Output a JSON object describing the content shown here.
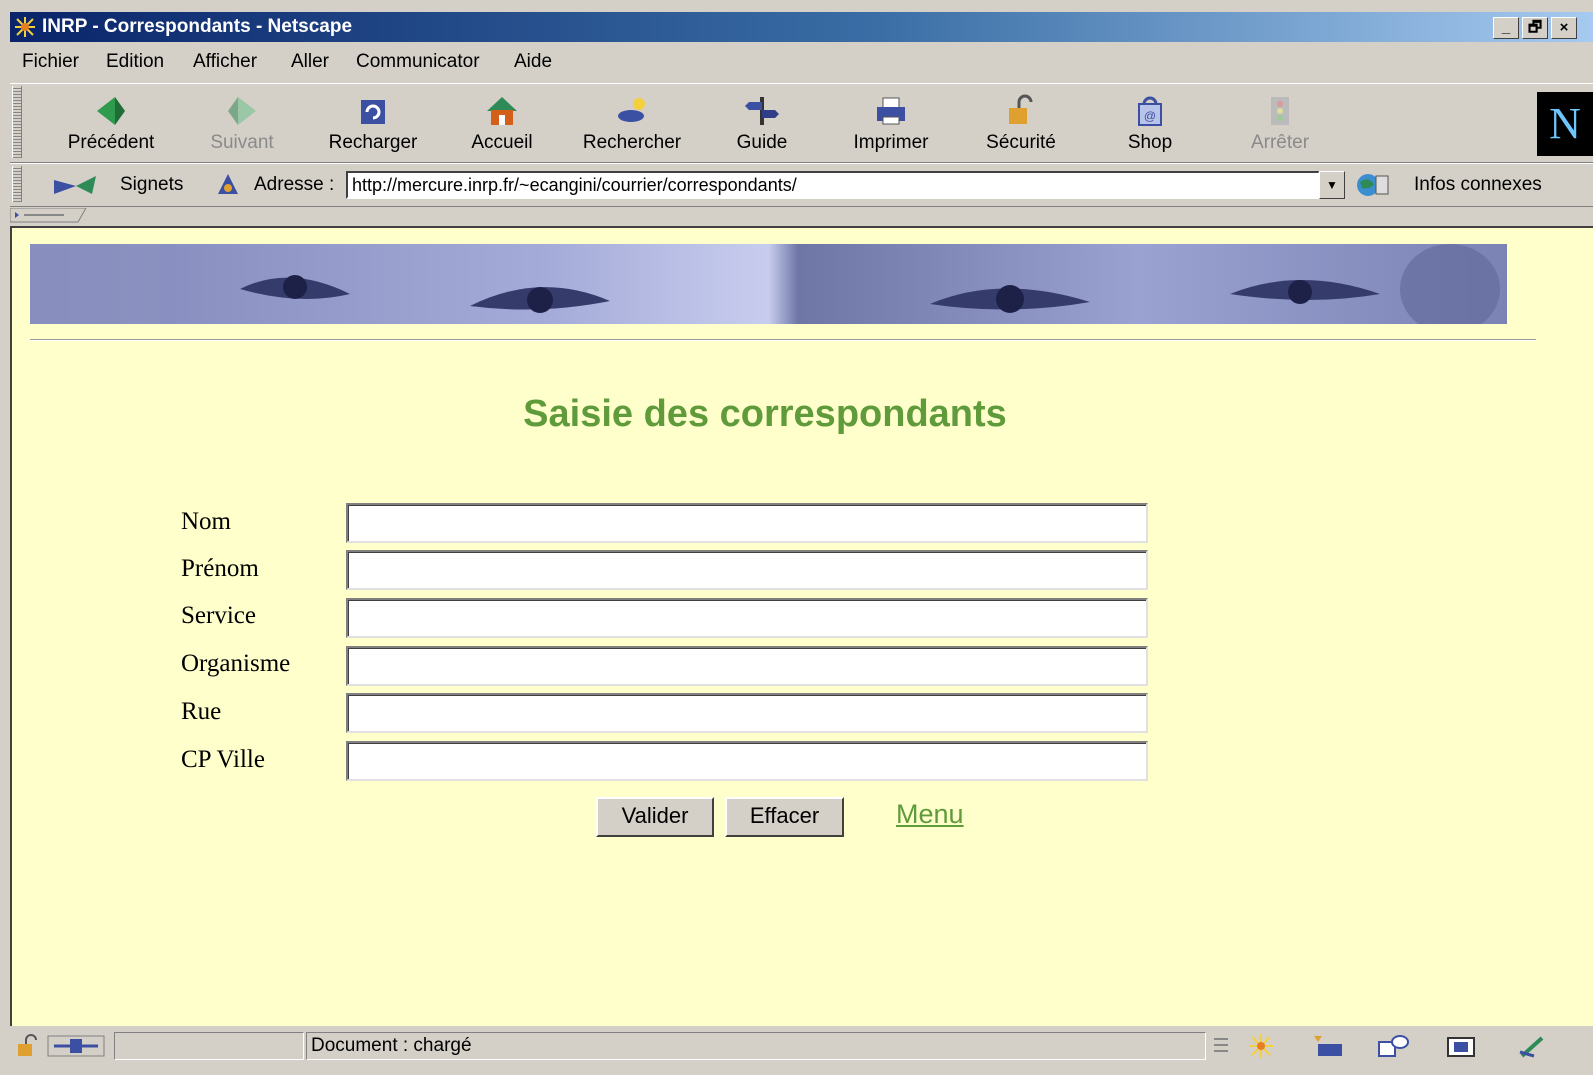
{
  "window": {
    "title": "INRP - Correspondants - Netscape",
    "controls": [
      "_",
      "🗗",
      "×"
    ]
  },
  "menu": [
    "Fichier",
    "Edition",
    "Afficher",
    "Aller",
    "Communicator",
    "Aide"
  ],
  "toolbar": {
    "buttons": [
      {
        "label": "Précédent",
        "icon": "back-arrow-icon",
        "enabled": true
      },
      {
        "label": "Suivant",
        "icon": "forward-arrow-icon",
        "enabled": false
      },
      {
        "label": "Recharger",
        "icon": "reload-icon",
        "enabled": true
      },
      {
        "label": "Accueil",
        "icon": "home-icon",
        "enabled": true
      },
      {
        "label": "Rechercher",
        "icon": "search-icon",
        "enabled": true
      },
      {
        "label": "Guide",
        "icon": "guide-icon",
        "enabled": true
      },
      {
        "label": "Imprimer",
        "icon": "printer-icon",
        "enabled": true
      },
      {
        "label": "Sécurité",
        "icon": "lock-icon",
        "enabled": true
      },
      {
        "label": "Shop",
        "icon": "shop-bag-icon",
        "enabled": true
      },
      {
        "label": "Arrêter",
        "icon": "stop-icon",
        "enabled": false
      }
    ],
    "brand_letter": "N"
  },
  "location": {
    "bookmarks_label": "Signets",
    "address_label": "Adresse :",
    "url": "http://mercure.inrp.fr/~ecangini/courrier/correspondants/",
    "related_label": "Infos connexes"
  },
  "page": {
    "background": "#ffffcc",
    "accent": "#5f9b3a",
    "title": "Saisie des correspondants",
    "fields": [
      {
        "label": "Nom",
        "value": ""
      },
      {
        "label": "Prénom",
        "value": ""
      },
      {
        "label": "Service",
        "value": ""
      },
      {
        "label": "Organisme",
        "value": ""
      },
      {
        "label": "Rue",
        "value": ""
      },
      {
        "label": "CP Ville",
        "value": ""
      }
    ],
    "submit_label": "Valider",
    "reset_label": "Effacer",
    "menu_link": "Menu"
  },
  "status": {
    "text": "Document : chargé"
  }
}
